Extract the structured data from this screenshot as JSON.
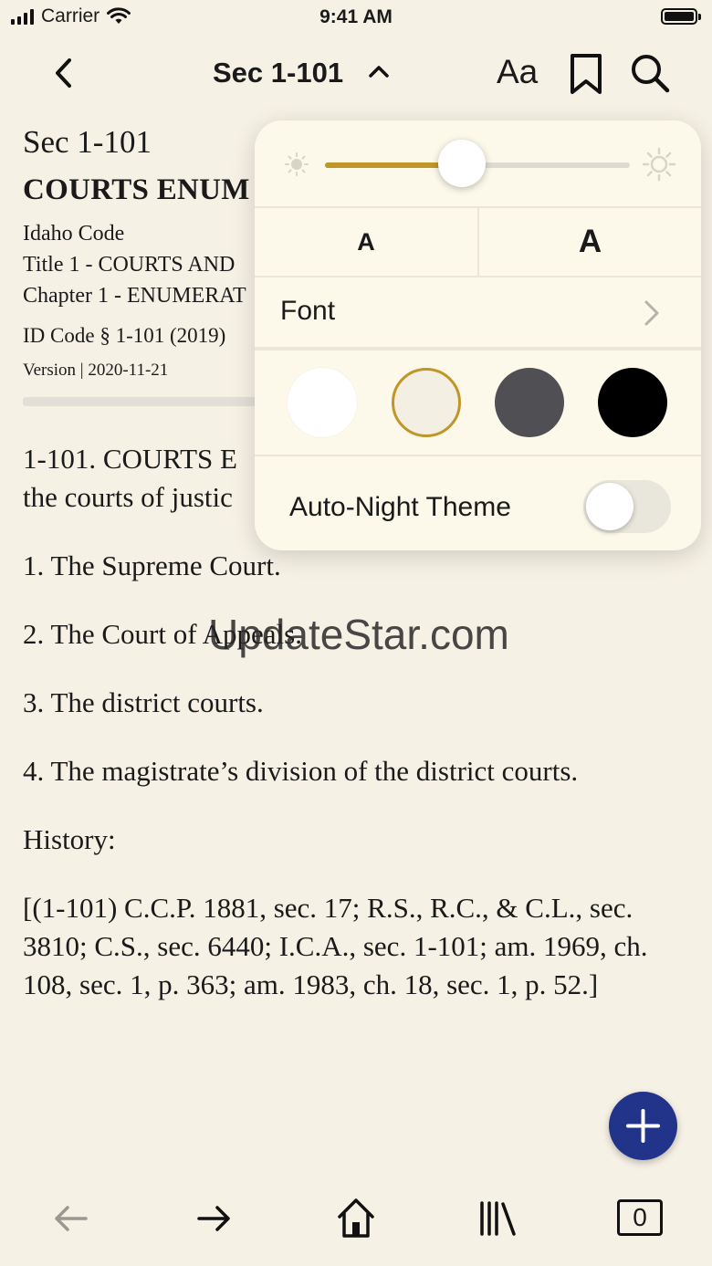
{
  "status_bar": {
    "carrier": "Carrier",
    "time": "9:41 AM"
  },
  "nav": {
    "title": "Sec 1-101",
    "font_settings_label": "Aa"
  },
  "document": {
    "section_label": "Sec 1-101",
    "title_visible": "COURTS ENUM",
    "meta_lines": [
      "Idaho Code",
      "Title 1 - COURTS AND",
      "Chapter 1 - ENUMERAT"
    ],
    "id_code": "ID Code § 1-101 (2019)",
    "version": "Version | 2020-11-21",
    "paragraphs": [
      "1-101. COURTS E the courts of justic",
      "1. The Supreme Court.",
      "2. The Court of Appeals.",
      "3. The district courts.",
      "4. The magistrate’s division of the district courts.",
      "History:",
      "[(1-101) C.C.P. 1881, sec. 17; R.S., R.C., & C.L., sec. 3810; C.S., sec. 6440; I.C.A., sec. 1-101; am. 1969, ch. 108, sec. 1, p. 363; am. 1983, ch. 18, sec. 1, p. 52.]"
    ],
    "first_para_line1": "1-101. COURTS E",
    "first_para_line2": "the courts of justic"
  },
  "watermark": "UpdateStar.com",
  "display_settings": {
    "brightness": 0.45,
    "font_size_smaller": "A",
    "font_size_larger": "A",
    "font_label": "Font",
    "themes": [
      {
        "name": "white",
        "color": "#ffffff",
        "selected": false
      },
      {
        "name": "sepia",
        "color": "#f3efe2",
        "selected": true
      },
      {
        "name": "gray",
        "color": "#505054",
        "selected": false
      },
      {
        "name": "black",
        "color": "#000000",
        "selected": false
      }
    ],
    "auto_night_label": "Auto-Night Theme",
    "auto_night_enabled": false
  },
  "bottom_bar": {
    "tabs_count": "0"
  },
  "colors": {
    "accent": "#c09628",
    "fab": "#22348a",
    "background": "#f6f1e5"
  }
}
